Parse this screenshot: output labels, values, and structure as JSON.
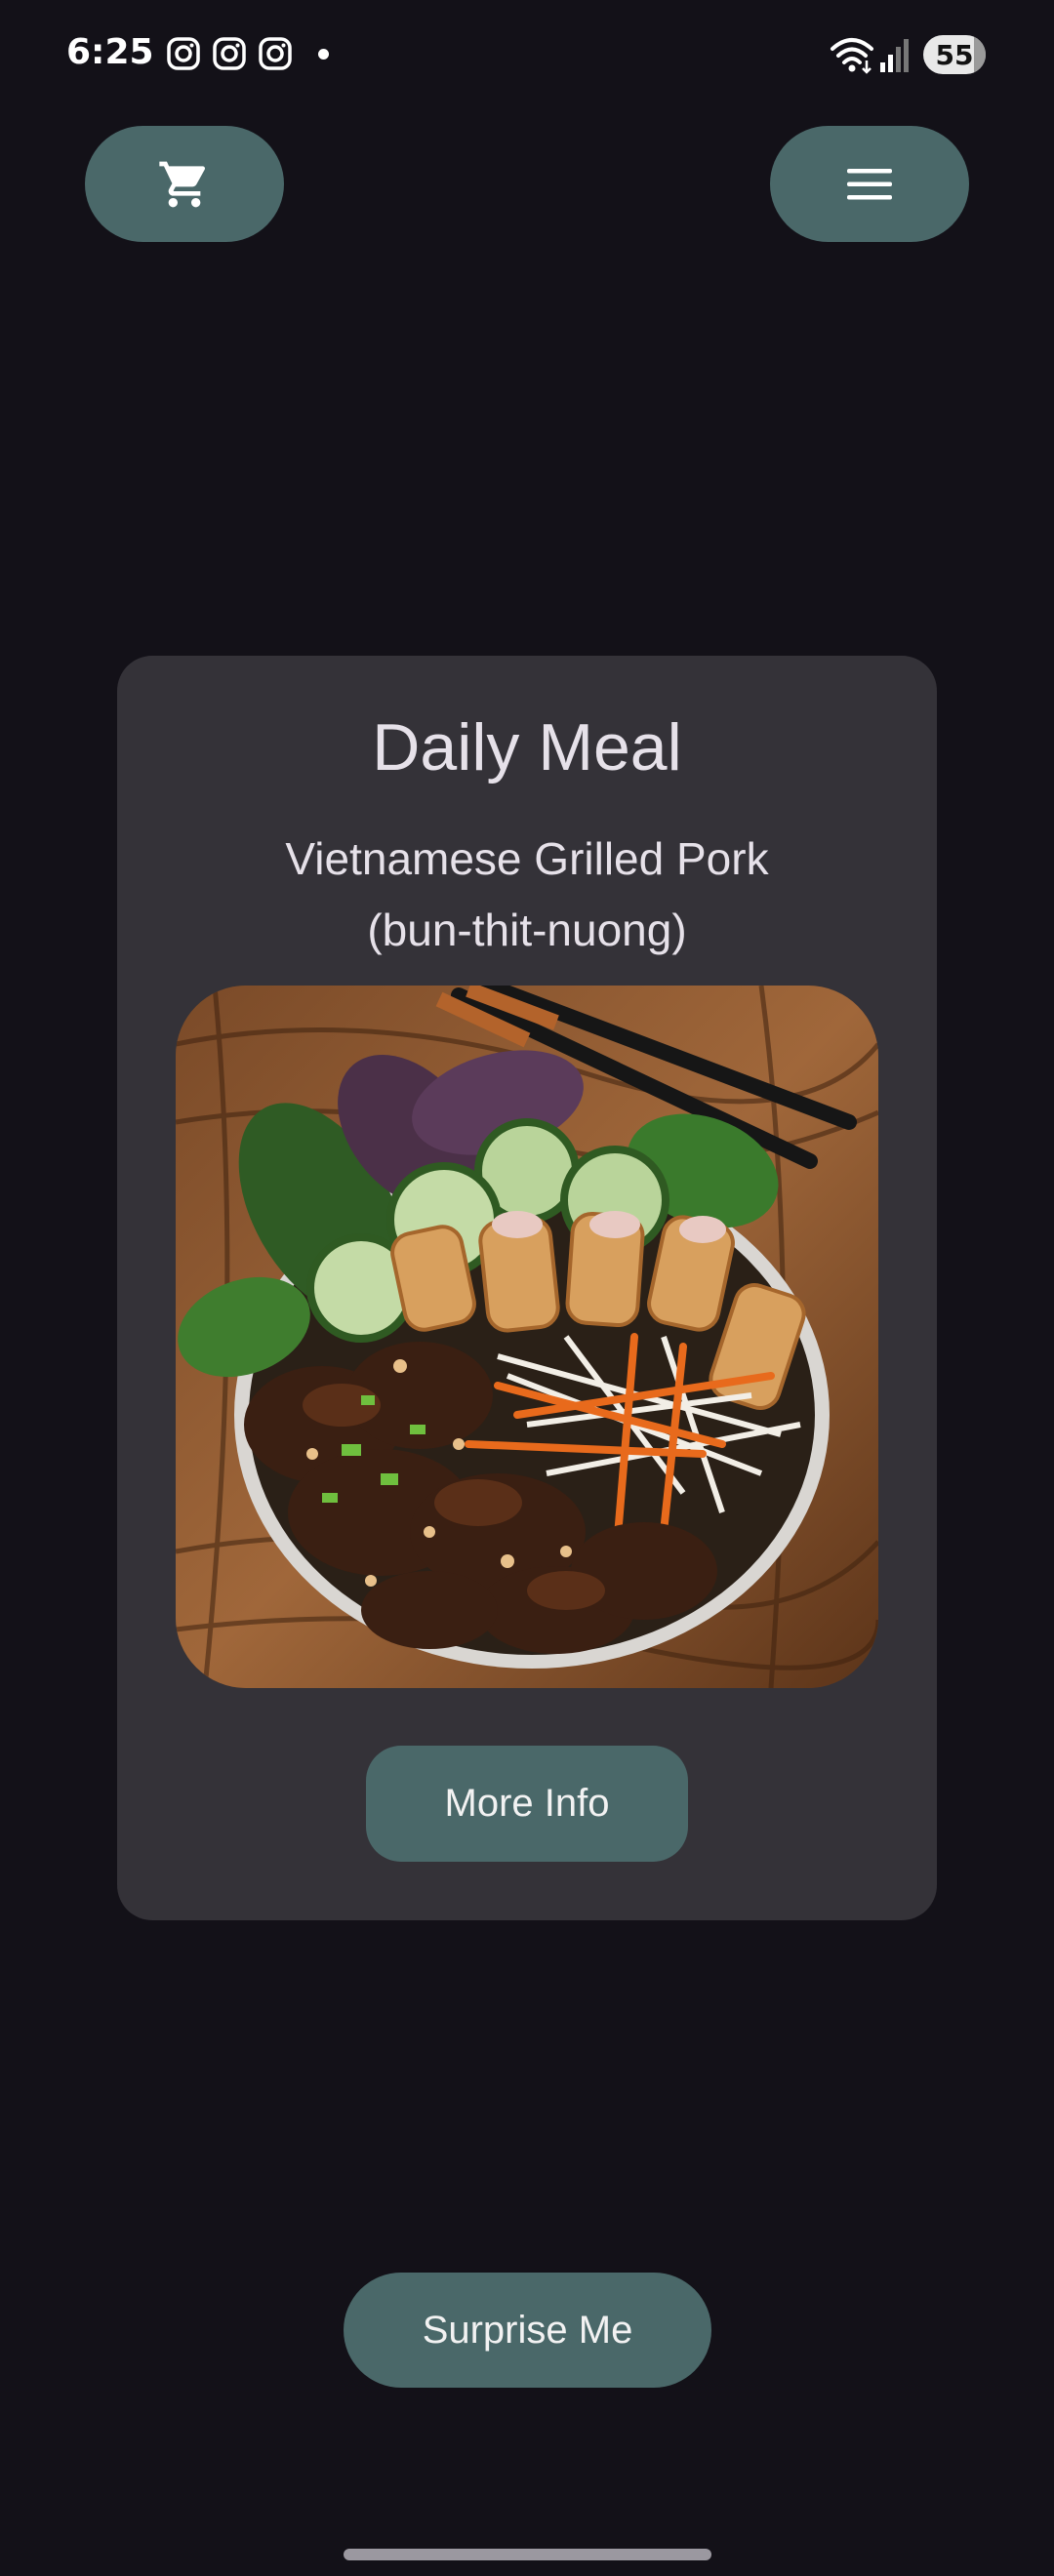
{
  "status_bar": {
    "time": "6:25",
    "notification_icons": [
      "instagram-icon",
      "instagram-icon",
      "instagram-icon",
      "notification-dot"
    ],
    "system_icons": [
      "wifi-icon",
      "signal-icon"
    ],
    "battery_level": "55"
  },
  "toolbar": {
    "cart_icon": "cart-icon",
    "menu_icon": "hamburger-menu-icon"
  },
  "card": {
    "title": "Daily Meal",
    "meal_name_line1": "Vietnamese Grilled Pork",
    "meal_name_line2": "(bun-thit-nuong)",
    "more_info_label": "More Info"
  },
  "actions": {
    "surprise_label": "Surprise Me"
  },
  "colors": {
    "background": "#131118",
    "card": "#343238",
    "button": "#4a6869",
    "text": "#e6e1e9"
  }
}
